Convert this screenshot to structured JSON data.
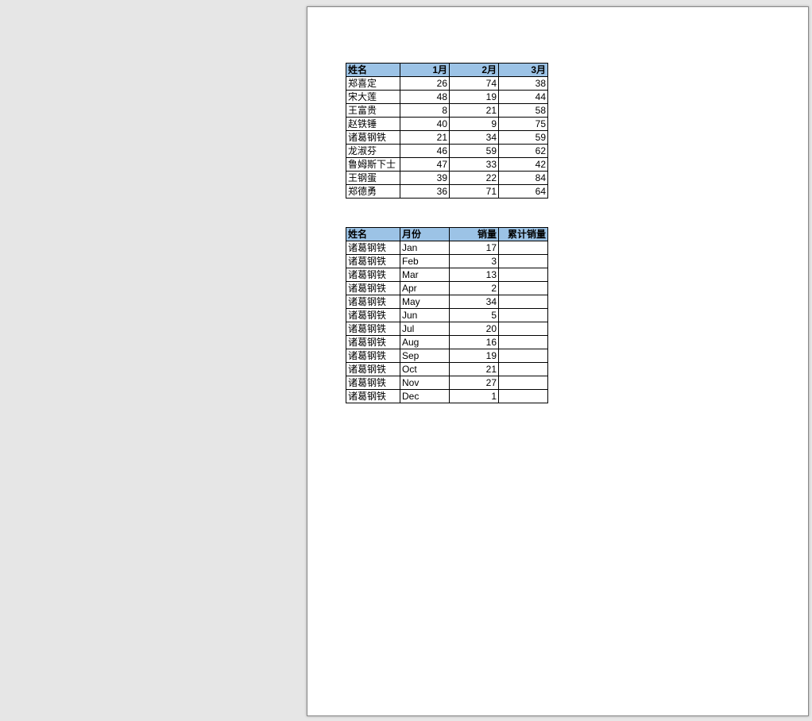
{
  "table1": {
    "headers": [
      "姓名",
      "1月",
      "2月",
      "3月"
    ],
    "rows": [
      {
        "name": "郑喜定",
        "m1": 26,
        "m2": 74,
        "m3": 38
      },
      {
        "name": "宋大莲",
        "m1": 48,
        "m2": 19,
        "m3": 44
      },
      {
        "name": "王富贵",
        "m1": 8,
        "m2": 21,
        "m3": 58
      },
      {
        "name": "赵铁锤",
        "m1": 40,
        "m2": 9,
        "m3": 75
      },
      {
        "name": "诸葛钢铁",
        "m1": 21,
        "m2": 34,
        "m3": 59
      },
      {
        "name": "龙淑芬",
        "m1": 46,
        "m2": 59,
        "m3": 62
      },
      {
        "name": "鲁姆斯下士",
        "m1": 47,
        "m2": 33,
        "m3": 42
      },
      {
        "name": "王钢蛋",
        "m1": 39,
        "m2": 22,
        "m3": 84
      },
      {
        "name": "郑德勇",
        "m1": 36,
        "m2": 71,
        "m3": 64
      }
    ]
  },
  "table2": {
    "headers": [
      "姓名",
      "月份",
      "销量",
      "累计销量"
    ],
    "rows": [
      {
        "name": "诸葛钢铁",
        "month": "Jan",
        "sales": 17,
        "cum": ""
      },
      {
        "name": "诸葛钢铁",
        "month": "Feb",
        "sales": 3,
        "cum": ""
      },
      {
        "name": "诸葛钢铁",
        "month": "Mar",
        "sales": 13,
        "cum": ""
      },
      {
        "name": "诸葛钢铁",
        "month": "Apr",
        "sales": 2,
        "cum": ""
      },
      {
        "name": "诸葛钢铁",
        "month": "May",
        "sales": 34,
        "cum": ""
      },
      {
        "name": "诸葛钢铁",
        "month": "Jun",
        "sales": 5,
        "cum": ""
      },
      {
        "name": "诸葛钢铁",
        "month": "Jul",
        "sales": 20,
        "cum": ""
      },
      {
        "name": "诸葛钢铁",
        "month": "Aug",
        "sales": 16,
        "cum": ""
      },
      {
        "name": "诸葛钢铁",
        "month": "Sep",
        "sales": 19,
        "cum": ""
      },
      {
        "name": "诸葛钢铁",
        "month": "Oct",
        "sales": 21,
        "cum": ""
      },
      {
        "name": "诸葛钢铁",
        "month": "Nov",
        "sales": 27,
        "cum": ""
      },
      {
        "name": "诸葛钢铁",
        "month": "Dec",
        "sales": 1,
        "cum": ""
      }
    ]
  }
}
